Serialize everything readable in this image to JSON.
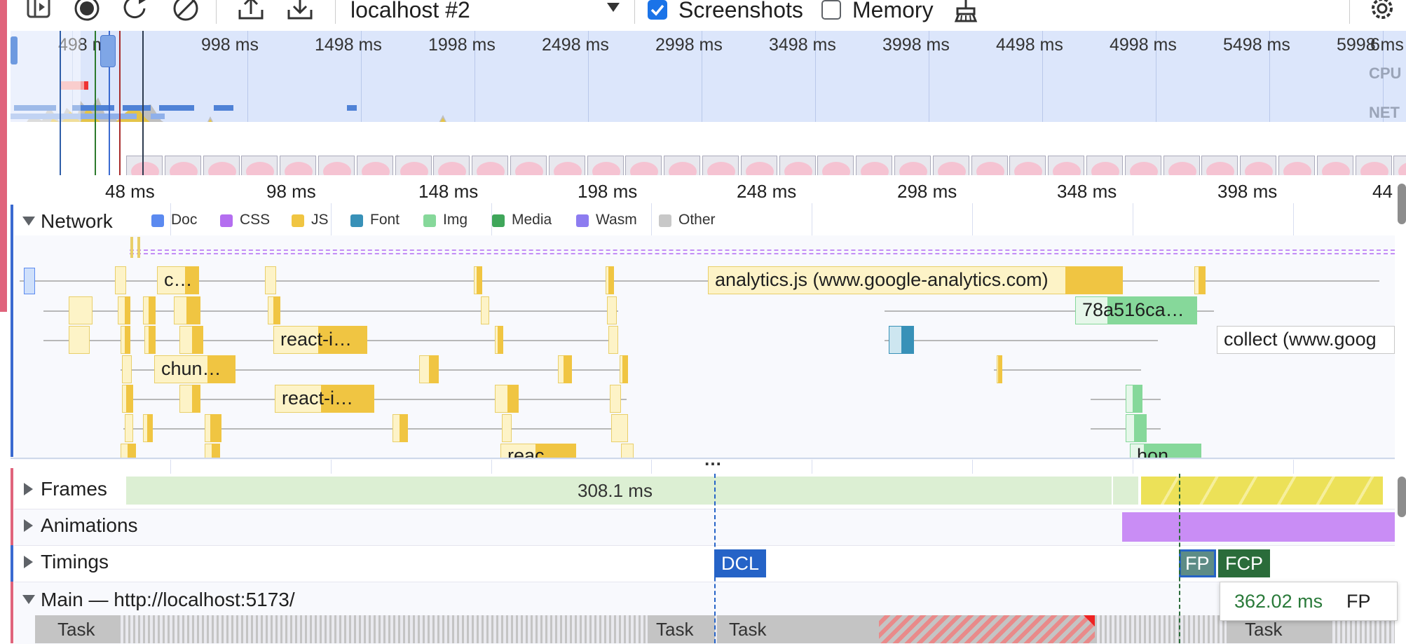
{
  "toolbar": {
    "target_select": "localhost #2",
    "screenshots_label": "Screenshots",
    "screenshots_checked": true,
    "memory_label": "Memory",
    "memory_checked": false,
    "icons": [
      "sidebar-toggle-icon",
      "record-icon",
      "reload-record-icon",
      "clear-icon",
      "upload-icon",
      "download-icon",
      "dropdown-arrow-icon",
      "broom-icon",
      "settings-gear-icon"
    ]
  },
  "overview": {
    "labels": [
      "498 ms",
      "998 ms",
      "1498 ms",
      "1998 ms",
      "2498 ms",
      "2998 ms",
      "3498 ms",
      "3998 ms",
      "4498 ms",
      "4998 ms",
      "5498 ms",
      "5998 ms",
      "6"
    ],
    "cpu_label": "CPU",
    "net_label": "NET"
  },
  "ruler": {
    "labels": [
      "48 ms",
      "98 ms",
      "148 ms",
      "198 ms",
      "248 ms",
      "298 ms",
      "348 ms",
      "398 ms",
      "44"
    ]
  },
  "network": {
    "title": "Network",
    "legend": [
      {
        "name": "Doc",
        "color": "#5b8af0"
      },
      {
        "name": "CSS",
        "color": "#b46ef0"
      },
      {
        "name": "JS",
        "color": "#f0c542"
      },
      {
        "name": "Font",
        "color": "#3891b8"
      },
      {
        "name": "Img",
        "color": "#86d89a"
      },
      {
        "name": "Media",
        "color": "#3fa65a"
      },
      {
        "name": "Wasm",
        "color": "#8d7cf0"
      },
      {
        "name": "Other",
        "color": "#c8c8c8"
      }
    ],
    "requests": [
      "c…",
      "analytics.js (www.google-analytics.com)",
      "78a516ca…",
      "react-i…",
      "collect (www.goog",
      "chun…",
      "react-i…",
      "reac",
      "hon"
    ],
    "more": "…"
  },
  "tracks": {
    "frames": {
      "title": "Frames",
      "value": "308.1 ms"
    },
    "animations": {
      "title": "Animations"
    },
    "timings": {
      "title": "Timings",
      "markers": [
        "DCL",
        "FP",
        "FCP"
      ]
    },
    "main": {
      "title": "Main — http://localhost:5173/",
      "tasks": [
        "Task",
        "Task",
        "Task",
        "Task"
      ]
    }
  },
  "tooltip": {
    "time": "362.02 ms",
    "label": "FP"
  }
}
